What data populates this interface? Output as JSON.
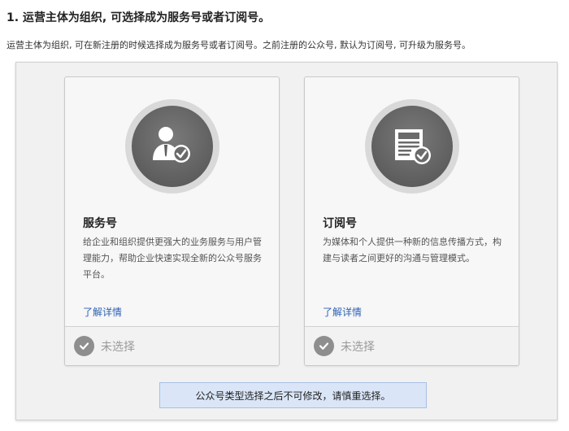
{
  "header": {
    "title": "1. 运营主体为组织, 可选择成为服务号或者订阅号。",
    "description": "运营主体为组织, 可在新注册的时候选择成为服务号或者订阅号。之前注册的公众号, 默认为订阅号, 可升级为服务号。"
  },
  "cards": [
    {
      "title": "服务号",
      "description": "给企业和组织提供更强大的业务服务与用户管理能力，帮助企业快速实现全新的公众号服务平台。",
      "link": "了解详情",
      "status": "未选择",
      "icon": "service-user-icon"
    },
    {
      "title": "订阅号",
      "description": "为媒体和个人提供一种新的信息传播方式，构建与读者之间更好的沟通与管理模式。",
      "link": "了解详情",
      "status": "未选择",
      "icon": "subscription-doc-icon"
    }
  ],
  "notice": "公众号类型选择之后不可修改，请慎重选择。",
  "colors": {
    "panel_bg": "#f1f1f1",
    "link": "#2d62b5",
    "notice_bg": "#dae6f8",
    "icon_bg": "#5e5e5e"
  }
}
